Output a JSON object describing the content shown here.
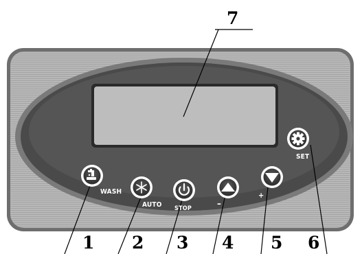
{
  "callouts": {
    "display": "7",
    "wash": "1",
    "auto": "2",
    "stop": "3",
    "up": "4",
    "down": "5",
    "set": "6"
  },
  "button_captions": {
    "wash": "WASH",
    "auto": "AUTO",
    "stop": "STOP",
    "up": "–",
    "down": "+",
    "set": "SET"
  },
  "icons": {
    "wash": "faucet-icon",
    "auto": "snowflake-icon",
    "stop": "power-icon",
    "up": "triangle-up-icon",
    "down": "triangle-down-icon",
    "set": "gear-icon"
  },
  "colors": {
    "panel_outer": "#b4b4b4",
    "panel_stripes": "#a3a3a3",
    "ellipse_outer": "#7d7d7d",
    "ellipse_inner": "#4e4e4e",
    "display": "#b9b9b9",
    "button_ring": "#ffffff",
    "button_fill": "#3d3d3d"
  }
}
